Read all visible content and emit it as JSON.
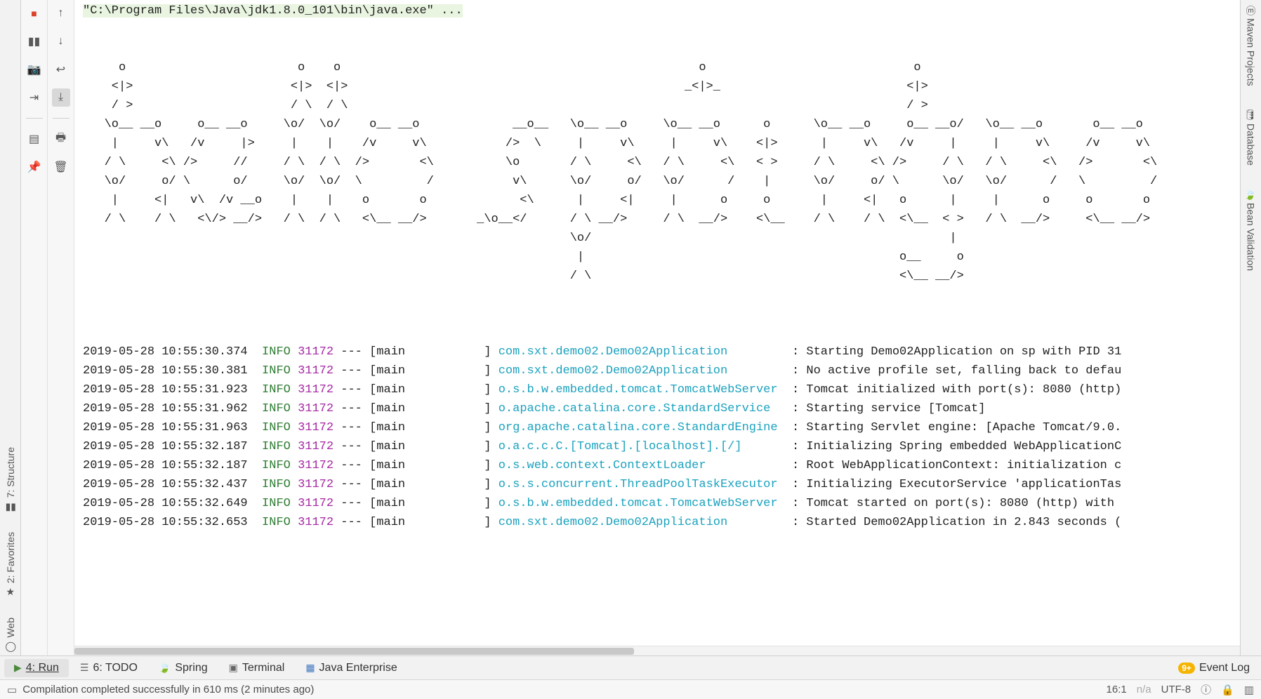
{
  "left_vert_tabs": {
    "structure": "7: Structure",
    "favorites": "2: Favorites",
    "web": "Web"
  },
  "right_vert_tabs": {
    "maven": "Maven Projects",
    "database": "Database",
    "bean_validation": "Bean Validation"
  },
  "run_toolbar": {
    "stop_title": "Stop",
    "pause_title": "Pause Output",
    "camera_title": "Dump Threads",
    "exit_title": "Exit",
    "layout_title": "Layout",
    "pin_title": "Pin Tab"
  },
  "console_toolbar": {
    "up_title": "Up the Stack Trace",
    "down_title": "Down the Stack Trace",
    "wrap_title": "Use Soft Wraps",
    "scroll_end_title": "Scroll to End",
    "print_title": "Print",
    "trash_title": "Clear All"
  },
  "console": {
    "command": "\"C:\\Program Files\\Java\\jdk1.8.0_101\\bin\\java.exe\" ...",
    "ascii": "     o                        o    o                                                  o                             o\n    <|>                      <|>  <|>                                               _<|>_                          <|>\n    / >                      / \\  / \\                                                                              / >\n   \\o__ __o     o__ __o     \\o/  \\o/    o__ __o             __o__   \\o__ __o     \\o__ __o      o      \\o__ __o     o__ __o/   \\o__ __o       o__ __o\n    |     v\\   /v     |>     |    |    /v     v\\           />  \\     |     v\\     |     v\\    <|>      |     v\\   /v     |     |     v\\     /v     v\\\n   / \\     <\\ />     //     / \\  / \\  />       <\\          \\o       / \\     <\\   / \\     <\\   < >     / \\     <\\ />     / \\   / \\     <\\   />       <\\\n   \\o/     o/ \\      o/     \\o/  \\o/  \\         /           v\\      \\o/     o/   \\o/      /    |      \\o/     o/ \\      \\o/   \\o/      /   \\         /\n    |     <|   v\\  /v __o    |    |    o       o             <\\      |     <|     |      o     o       |     <|   o      |     |      o     o       o\n   / \\    / \\   <\\/> __/>   / \\  / \\   <\\__ __/>       _\\o__</      / \\ __/>     / \\  __/>    <\\__    / \\    / \\  <\\__  < >   / \\  __/>     <\\__ __/>\n                                                                    \\o/                                                  |\n                                                                     |                                            o__     o\n                                                                    / \\                                           <\\__ __/>",
    "log_lines": [
      {
        "ts": "2019-05-28 10:55:30.374",
        "lvl": "INFO",
        "pid": "31172",
        "thread": "main",
        "logger": "com.sxt.demo02.Demo02Application",
        "msg": "Starting Demo02Application on sp with PID 31"
      },
      {
        "ts": "2019-05-28 10:55:30.381",
        "lvl": "INFO",
        "pid": "31172",
        "thread": "main",
        "logger": "com.sxt.demo02.Demo02Application",
        "msg": "No active profile set, falling back to defau"
      },
      {
        "ts": "2019-05-28 10:55:31.923",
        "lvl": "INFO",
        "pid": "31172",
        "thread": "main",
        "logger": "o.s.b.w.embedded.tomcat.TomcatWebServer",
        "msg": "Tomcat initialized with port(s): 8080 (http)"
      },
      {
        "ts": "2019-05-28 10:55:31.962",
        "lvl": "INFO",
        "pid": "31172",
        "thread": "main",
        "logger": "o.apache.catalina.core.StandardService",
        "msg": "Starting service [Tomcat]"
      },
      {
        "ts": "2019-05-28 10:55:31.963",
        "lvl": "INFO",
        "pid": "31172",
        "thread": "main",
        "logger": "org.apache.catalina.core.StandardEngine",
        "msg": "Starting Servlet engine: [Apache Tomcat/9.0."
      },
      {
        "ts": "2019-05-28 10:55:32.187",
        "lvl": "INFO",
        "pid": "31172",
        "thread": "main",
        "logger": "o.a.c.c.C.[Tomcat].[localhost].[/]",
        "msg": "Initializing Spring embedded WebApplicationC"
      },
      {
        "ts": "2019-05-28 10:55:32.187",
        "lvl": "INFO",
        "pid": "31172",
        "thread": "main",
        "logger": "o.s.web.context.ContextLoader",
        "msg": "Root WebApplicationContext: initialization c"
      },
      {
        "ts": "2019-05-28 10:55:32.437",
        "lvl": "INFO",
        "pid": "31172",
        "thread": "main",
        "logger": "o.s.s.concurrent.ThreadPoolTaskExecutor",
        "msg": "Initializing ExecutorService 'applicationTas"
      },
      {
        "ts": "2019-05-28 10:55:32.649",
        "lvl": "INFO",
        "pid": "31172",
        "thread": "main",
        "logger": "o.s.b.w.embedded.tomcat.TomcatWebServer",
        "msg": "Tomcat started on port(s): 8080 (http) with "
      },
      {
        "ts": "2019-05-28 10:55:32.653",
        "lvl": "INFO",
        "pid": "31172",
        "thread": "main",
        "logger": "com.sxt.demo02.Demo02Application",
        "msg": "Started Demo02Application in 2.843 seconds ("
      }
    ]
  },
  "bottom_tabs": {
    "run": "4: Run",
    "todo": "6: TODO",
    "spring": "Spring",
    "terminal": "Terminal",
    "java_ee": "Java Enterprise",
    "event_log": "Event Log",
    "event_badge": "9+"
  },
  "status": {
    "message": "Compilation completed successfully in 610 ms (2 minutes ago)",
    "caret": "16:1",
    "na": "n/a",
    "encoding": "UTF-8"
  }
}
